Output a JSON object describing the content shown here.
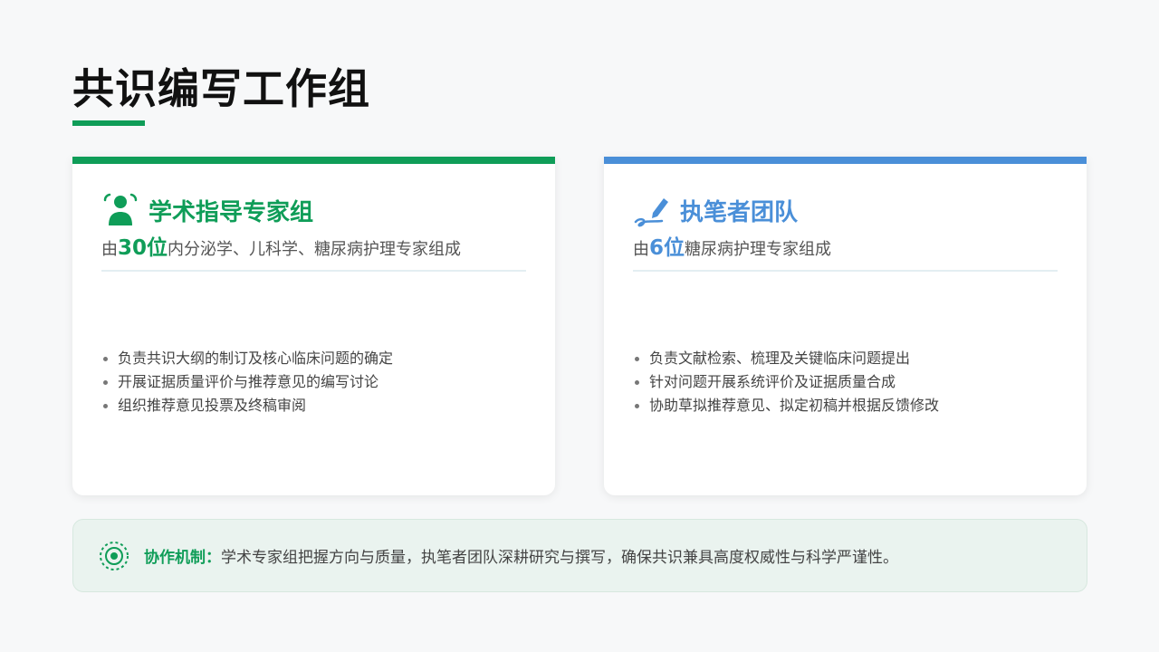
{
  "page": {
    "title": "共识编写工作组"
  },
  "colors": {
    "green": "#0f9d58",
    "blue": "#4a8fd8"
  },
  "cards": [
    {
      "icon": "person-group-icon",
      "title": "学术指导专家组",
      "sub_prefix": "由",
      "sub_highlight": "30位",
      "sub_rest": "内分泌学、儿科学、糖尿病护理专家组成",
      "bullets": [
        "负责共识大纲的制订及核心临床问题的确定",
        "开展证据质量评价与推荐意见的编写讨论",
        "组织推荐意见投票及终稿审阅"
      ]
    },
    {
      "icon": "pen-writing-icon",
      "title": "执笔者团队",
      "sub_prefix": "由",
      "sub_highlight": "6位",
      "sub_rest": "糖尿病护理专家组成",
      "bullets": [
        "负责文献检索、梳理及关键临床问题提出",
        "针对问题开展系统评价及证据质量合成",
        "协助草拟推荐意见、拟定初稿并根据反馈修改"
      ]
    }
  ],
  "footer": {
    "icon": "target-circle-icon",
    "label": "协作机制：",
    "text": "学术专家组把握方向与质量，执笔者团队深耕研究与撰写，确保共识兼具高度权威性与科学严谨性。"
  }
}
